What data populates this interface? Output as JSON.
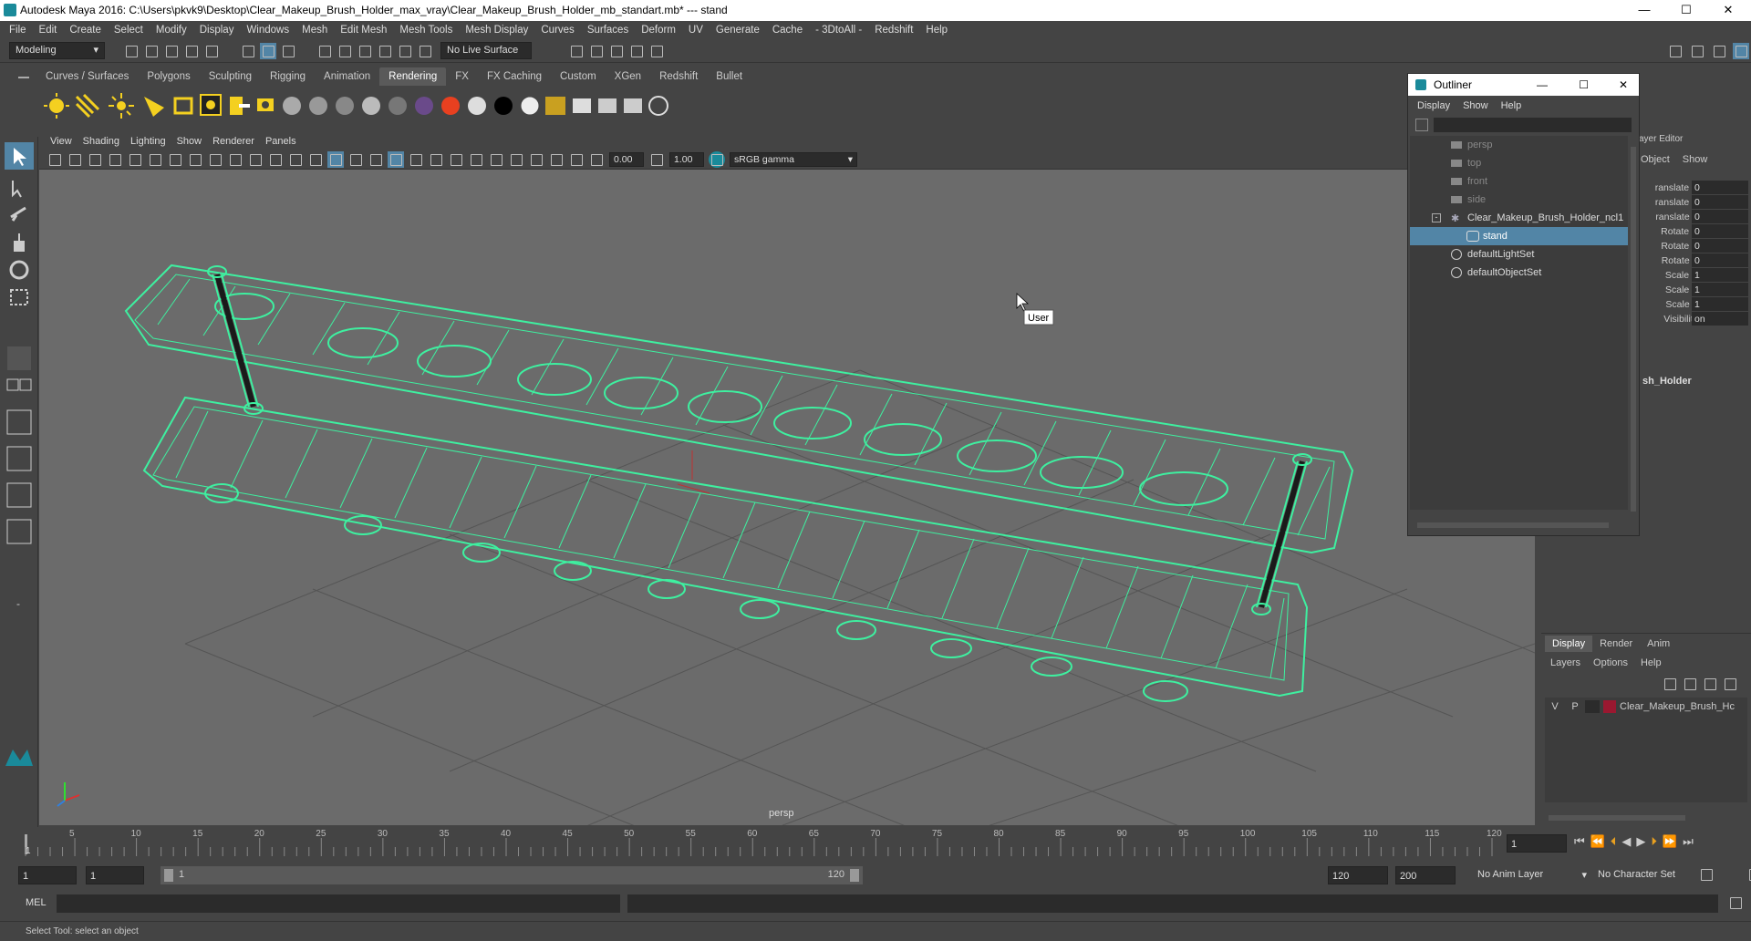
{
  "titlebar": {
    "title": "Autodesk Maya 2016: C:\\Users\\pkvk9\\Desktop\\Clear_Makeup_Brush_Holder_max_vray\\Clear_Makeup_Brush_Holder_mb_standart.mb*   ---   stand",
    "minimize": "—",
    "maximize": "☐",
    "close": "✕"
  },
  "menubar": [
    "File",
    "Edit",
    "Create",
    "Select",
    "Modify",
    "Display",
    "Windows",
    "Mesh",
    "Edit Mesh",
    "Mesh Tools",
    "Mesh Display",
    "Curves",
    "Surfaces",
    "Deform",
    "UV",
    "Generate",
    "Cache",
    "- 3DtoAll -",
    "Redshift",
    "Help"
  ],
  "statusline": {
    "mode": "Modeling",
    "live_surface": "No Live Surface"
  },
  "shelf_tabs": [
    "Curves / Surfaces",
    "Polygons",
    "Sculpting",
    "Rigging",
    "Animation",
    "Rendering",
    "FX",
    "FX Caching",
    "Custom",
    "XGen",
    "Redshift",
    "Bullet"
  ],
  "active_shelf_tab": "Rendering",
  "panel_menu": [
    "View",
    "Shading",
    "Lighting",
    "Show",
    "Renderer",
    "Panels"
  ],
  "panel_toolbar": {
    "exposure": "0.00",
    "gamma": "1.00",
    "colorspace": "sRGB gamma"
  },
  "viewport": {
    "camera_label": "persp",
    "tooltip": "User",
    "wire_color": "#3ef0a0"
  },
  "outliner": {
    "title": "Outliner",
    "menu": [
      "Display",
      "Show",
      "Help"
    ],
    "items": [
      {
        "label": "persp",
        "state": "dim"
      },
      {
        "label": "top",
        "state": "dim"
      },
      {
        "label": "front",
        "state": "dim"
      },
      {
        "label": "side",
        "state": "dim"
      },
      {
        "label": "Clear_Makeup_Brush_Holder_ncl1",
        "state": "normal"
      },
      {
        "label": "stand",
        "state": "selected"
      },
      {
        "label": "defaultLightSet",
        "state": "normal"
      },
      {
        "label": "defaultObjectSet",
        "state": "normal"
      }
    ]
  },
  "channelbox": {
    "header": "ayer Editor",
    "tabs": [
      "Object",
      "Show"
    ],
    "channels": [
      {
        "label": "ranslate X",
        "value": "0"
      },
      {
        "label": "ranslate Y",
        "value": "0"
      },
      {
        "label": "ranslate Z",
        "value": "0"
      },
      {
        "label": "Rotate X",
        "value": "0"
      },
      {
        "label": "Rotate Y",
        "value": "0"
      },
      {
        "label": "Rotate Z",
        "value": "0"
      },
      {
        "label": "Scale X",
        "value": "1"
      },
      {
        "label": "Scale Y",
        "value": "1"
      },
      {
        "label": "Scale Z",
        "value": "1"
      },
      {
        "label": "Visibility",
        "value": "on"
      }
    ],
    "shape_label": "sh_Holder"
  },
  "layers": {
    "tabs": [
      "Display",
      "Render",
      "Anim"
    ],
    "menu": [
      "Layers",
      "Options",
      "Help"
    ],
    "layer": {
      "v": "V",
      "p": "P",
      "name": "Clear_Makeup_Brush_Hc",
      "color": "#9a1830"
    }
  },
  "timeline": {
    "ticks": [
      "5",
      "10",
      "15",
      "20",
      "25",
      "30",
      "35",
      "40",
      "45",
      "50",
      "55",
      "60",
      "65",
      "70",
      "75",
      "80",
      "85",
      "90",
      "95",
      "100",
      "105",
      "110",
      "115",
      "120"
    ],
    "current_frame": "1",
    "start_marker": "1"
  },
  "rangebar": {
    "start": "1",
    "inner_start": "1",
    "range_start_label": "1",
    "range_end_label": "120",
    "end": "120",
    "outer_end": "200",
    "anim_layer": "No Anim Layer",
    "character_set": "No Character Set"
  },
  "cmdline": {
    "lang": "MEL"
  },
  "helpline": {
    "text": "Select Tool: select an object"
  }
}
